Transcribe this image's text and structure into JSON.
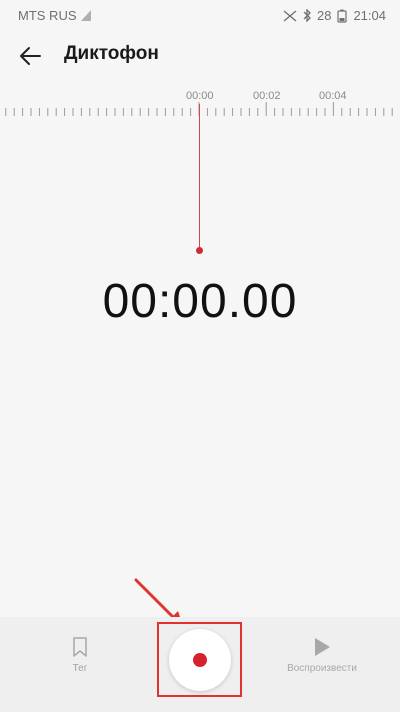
{
  "status_bar": {
    "carrier": "MTS RUS",
    "battery_level": "28",
    "time": "21:04",
    "icons": [
      "sim-icon",
      "nfc-icon",
      "bluetooth-icon",
      "battery-icon"
    ]
  },
  "app_bar": {
    "title": "Диктофон",
    "back_icon": "arrow-back-icon"
  },
  "timeline": {
    "ticks": [
      "00:00",
      "00:02",
      "00:04"
    ]
  },
  "timer": {
    "value": "00:00.00"
  },
  "bottom_bar": {
    "tag_label": "Тег",
    "play_label": "Воспроизвести",
    "record_icon": "record-icon"
  },
  "colors": {
    "accent": "#d6222d",
    "highlight": "#e0332f",
    "background": "#f6f6f6"
  }
}
